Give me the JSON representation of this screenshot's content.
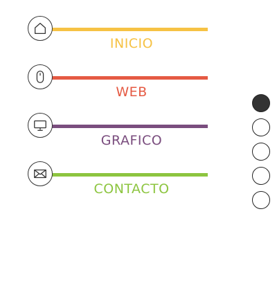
{
  "nav": {
    "items": [
      {
        "label": "INICIO",
        "icon": "home-icon",
        "color": "#f6c244"
      },
      {
        "label": "WEB",
        "icon": "mouse-icon",
        "color": "#e55a43"
      },
      {
        "label": "GRAFICO",
        "icon": "monitor-icon",
        "color": "#7a4d7e"
      },
      {
        "label": "CONTACTO",
        "icon": "mail-icon",
        "color": "#8dc540"
      }
    ]
  },
  "pager": {
    "count": 5,
    "active_index": 0
  }
}
